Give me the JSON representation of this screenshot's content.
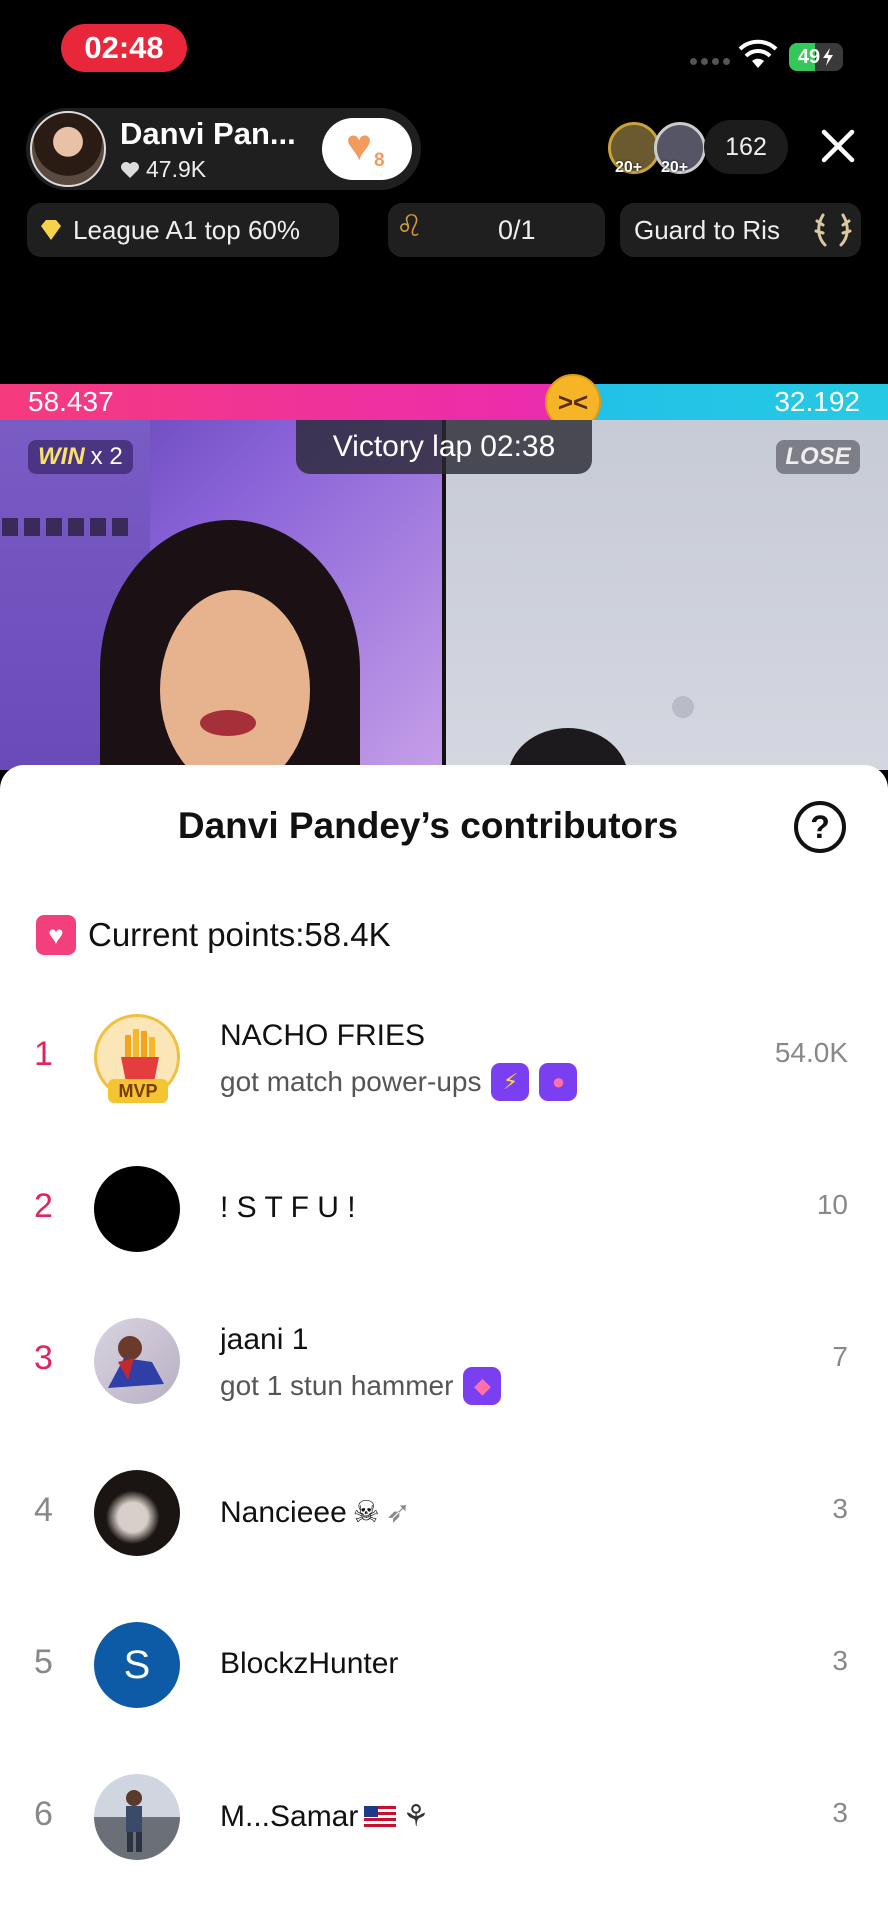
{
  "status_bar": {
    "time": "02:48",
    "battery_percent": 49
  },
  "host": {
    "name": "Danvi Pan...",
    "likes": "47.9K",
    "follow_badge_count": "8"
  },
  "viewers": {
    "avatar_badges": [
      "20+",
      "20+"
    ],
    "count": "162"
  },
  "chips": {
    "league": "League A1 top 60%",
    "gift_progress": "0/1",
    "guard": "Guard to Ris"
  },
  "battle": {
    "left_score": "58.437",
    "right_score": "32.192",
    "left_score_value": 58437,
    "right_score_value": 32192,
    "win_label": "WIN",
    "win_multiplier": "x 2",
    "timer_label": "Victory lap",
    "timer_value": "02:38",
    "lose_label": "LOSE"
  },
  "panel": {
    "title": "Danvi Pandey’s contributors",
    "help": "?",
    "current_points": "Current points:58.4K",
    "contributors": [
      {
        "rank": "1",
        "name": "NACHO FRIES",
        "sub": "got match power-ups",
        "score": "54.0K",
        "badge": "MVP"
      },
      {
        "rank": "2",
        "name": "! S T F U  !",
        "sub": "",
        "score": "10"
      },
      {
        "rank": "3",
        "name": "jaani 1",
        "sub": "got 1 stun hammer",
        "score": "7"
      },
      {
        "rank": "4",
        "name": "Nancieee",
        "sub": "",
        "score": "3"
      },
      {
        "rank": "5",
        "name": "BlockzHunter",
        "sub": "",
        "score": "3",
        "avatar_letter": "S"
      },
      {
        "rank": "6",
        "name": "M...Samar",
        "sub": "",
        "score": "3"
      }
    ]
  },
  "colors": {
    "accent_pink": "#e0245e",
    "battle_left": "#f53b7e",
    "battle_right": "#22c1e8",
    "status_red": "#e8283a"
  }
}
